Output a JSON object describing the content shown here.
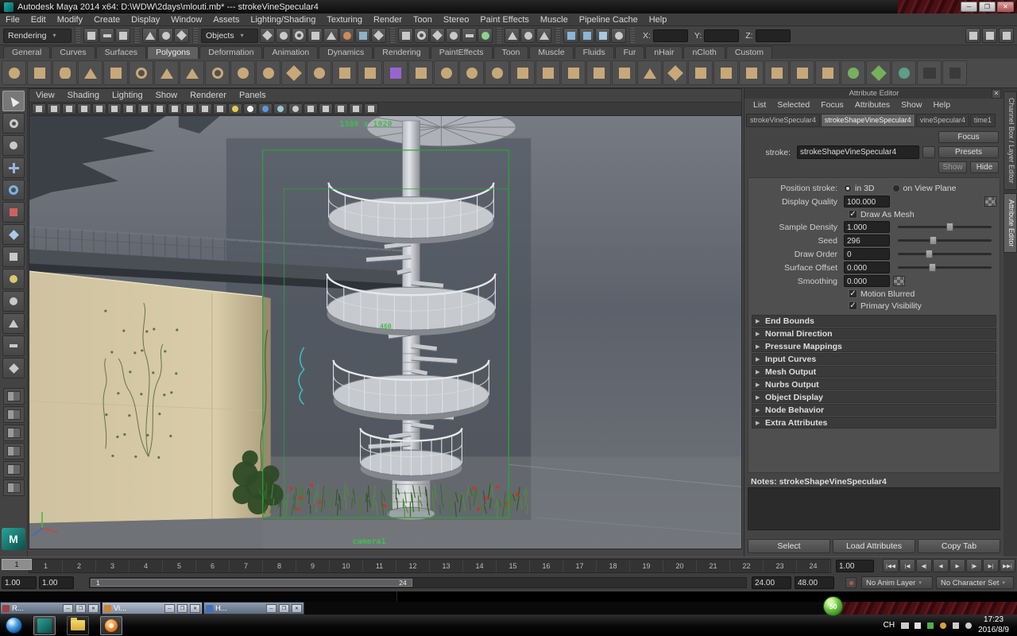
{
  "window": {
    "title": "Autodesk Maya 2014 x64: D:\\WDW\\2days\\mlouti.mb*   --- strokeVineSpecular4"
  },
  "menu_bar": [
    "File",
    "Edit",
    "Modify",
    "Create",
    "Display",
    "Window",
    "Assets",
    "Lighting/Shading",
    "Texturing",
    "Render",
    "Toon",
    "Stereo",
    "Paint Effects",
    "Muscle",
    "Pipeline Cache",
    "Help"
  ],
  "status_line": {
    "menu_set": "Rendering",
    "selection_mask_label": "Objects",
    "coords": {
      "x_label": "X:",
      "x_value": "",
      "y_label": "Y:",
      "y_value": "",
      "z_label": "Z:",
      "z_value": ""
    },
    "file_icons": [
      {
        "name": "new-scene-icon",
        "shape": "sq"
      },
      {
        "name": "open-scene-icon",
        "shape": "pl"
      },
      {
        "name": "save-scene-icon",
        "shape": "sq"
      }
    ],
    "selection_mode_icons": [
      {
        "name": "select-hierarchy-icon",
        "shape": "tr"
      },
      {
        "name": "select-object-icon",
        "shape": "ci"
      },
      {
        "name": "select-component-icon",
        "shape": "di"
      }
    ],
    "mask_icons": [
      {
        "name": "select-handles-icon",
        "shape": "di"
      },
      {
        "name": "select-joints-icon",
        "shape": "ci"
      },
      {
        "name": "select-curves-icon",
        "shape": "to"
      },
      {
        "name": "select-surfaces-icon",
        "shape": "sq"
      },
      {
        "name": "select-deformations-icon",
        "shape": "tr"
      },
      {
        "name": "select-dynamics-icon",
        "shape": "ci",
        "color": "#d08a5a"
      },
      {
        "name": "select-rendering-icon",
        "shape": "sq",
        "color": "#8fb3c8"
      },
      {
        "name": "select-misc-icon",
        "shape": "di"
      }
    ],
    "snap_icons": [
      {
        "name": "snap-to-grid-icon",
        "shape": "sq"
      },
      {
        "name": "snap-to-curve-icon",
        "shape": "to"
      },
      {
        "name": "snap-to-point-icon",
        "shape": "di"
      },
      {
        "name": "snap-to-projected-center-icon",
        "shape": "ci"
      },
      {
        "name": "snap-to-view-plane-icon",
        "shape": "pl"
      },
      {
        "name": "make-live-icon",
        "shape": "ci",
        "color": "#8fd18f"
      }
    ],
    "history_icons": [
      {
        "name": "input-connections-icon",
        "shape": "tr"
      },
      {
        "name": "construction-history-icon",
        "shape": "ci"
      },
      {
        "name": "output-connections-icon",
        "shape": "tr"
      }
    ],
    "render_icons": [
      {
        "name": "render-view-icon",
        "shape": "sq",
        "color": "#8ab6d8"
      },
      {
        "name": "render-current-frame-icon",
        "shape": "sq",
        "color": "#8ab6d8"
      },
      {
        "name": "ipr-render-icon",
        "shape": "sq",
        "color": "#a8c8e0"
      },
      {
        "name": "render-settings-icon",
        "shape": "ci"
      }
    ],
    "sidebar_icons": [
      {
        "name": "sidebar-attribute-editor-icon",
        "shape": "sq"
      },
      {
        "name": "sidebar-tool-settings-icon",
        "shape": "sq"
      },
      {
        "name": "sidebar-channel-box-icon",
        "shape": "sq"
      }
    ]
  },
  "shelf": {
    "tabs": [
      {
        "label": "General"
      },
      {
        "label": "Curves"
      },
      {
        "label": "Surfaces"
      },
      {
        "label": "Polygons",
        "active": true
      },
      {
        "label": "Deformation"
      },
      {
        "label": "Animation"
      },
      {
        "label": "Dynamics"
      },
      {
        "label": "Rendering"
      },
      {
        "label": "PaintEffects"
      },
      {
        "label": "Toon"
      },
      {
        "label": "Muscle"
      },
      {
        "label": "Fluids"
      },
      {
        "label": "Fur"
      },
      {
        "label": "nHair"
      },
      {
        "label": "nCloth"
      },
      {
        "label": "Custom"
      }
    ],
    "icons": [
      {
        "name": "poly-sphere-icon",
        "shape": "ci"
      },
      {
        "name": "poly-cube-icon",
        "shape": "sq"
      },
      {
        "name": "poly-cylinder-icon",
        "shape": "cy"
      },
      {
        "name": "poly-cone-icon",
        "shape": "tr"
      },
      {
        "name": "poly-plane-icon",
        "shape": "pl"
      },
      {
        "name": "poly-torus-icon",
        "shape": "to"
      },
      {
        "name": "poly-prism-icon",
        "shape": "tr"
      },
      {
        "name": "poly-pyramid-icon",
        "shape": "tr"
      },
      {
        "name": "poly-pipe-icon",
        "shape": "to"
      },
      {
        "name": "poly-helix-icon",
        "shape": "ci"
      },
      {
        "name": "poly-soccer-ball-icon",
        "shape": "ci"
      },
      {
        "name": "poly-platonic-solid-icon",
        "shape": "di"
      },
      {
        "name": "sculpt-geometry-icon",
        "shape": "ci"
      },
      {
        "name": "poly-combine-icon",
        "shape": "sq"
      },
      {
        "name": "poly-separate-icon",
        "shape": "sq"
      },
      {
        "name": "subdiv-cube-icon",
        "shape": "sq",
        "color": "#9a63d2"
      },
      {
        "name": "poly-extract-icon",
        "shape": "sq"
      },
      {
        "name": "boolean-union-icon",
        "shape": "ci"
      },
      {
        "name": "boolean-difference-icon",
        "shape": "ci"
      },
      {
        "name": "boolean-intersection-icon",
        "shape": "ci"
      },
      {
        "name": "poly-smooth-icon",
        "shape": "sq"
      },
      {
        "name": "poly-reduce-icon",
        "shape": "sq"
      },
      {
        "name": "poly-extrude-icon",
        "shape": "sq"
      },
      {
        "name": "poly-bridge-icon",
        "shape": "sq"
      },
      {
        "name": "append-to-polygon-icon",
        "shape": "sq"
      },
      {
        "name": "poly-wedge-icon",
        "shape": "tr"
      },
      {
        "name": "poly-poke-icon",
        "shape": "di"
      },
      {
        "name": "poly-cut-icon",
        "shape": "sq"
      },
      {
        "name": "split-polygon-icon",
        "shape": "sq"
      },
      {
        "name": "insert-edge-loop-icon",
        "shape": "sq"
      },
      {
        "name": "offset-edge-loop-icon",
        "shape": "sq"
      },
      {
        "name": "add-divisions-icon",
        "shape": "sq"
      },
      {
        "name": "poly-mirror-icon",
        "shape": "sq"
      },
      {
        "name": "merge-vertices-icon",
        "shape": "ci",
        "color": "#76b05c"
      },
      {
        "name": "target-weld-icon",
        "shape": "di",
        "color": "#76b05c"
      },
      {
        "name": "spin-edge-icon",
        "shape": "ci",
        "color": "#5c9e86"
      },
      {
        "name": "triangulate-icon",
        "shape": "tr",
        "color": "#3a3a3a"
      },
      {
        "name": "quadrangulate-icon",
        "shape": "sq",
        "color": "#3a3a3a"
      }
    ]
  },
  "toolbox": {
    "tools": [
      {
        "name": "select-tool",
        "shape": "ar",
        "active": true
      },
      {
        "name": "lasso-select-tool",
        "shape": "to"
      },
      {
        "name": "paint-select-tool",
        "shape": "ci"
      },
      {
        "name": "move-tool",
        "shape": "cr"
      },
      {
        "name": "rotate-tool",
        "shape": "rg"
      },
      {
        "name": "scale-tool",
        "shape": "sq",
        "color": "#d06060"
      },
      {
        "name": "show-manipulator-tool",
        "shape": "di",
        "color": "#b0c8e8"
      },
      {
        "name": "last-tool",
        "shape": "sq"
      },
      {
        "name": "soft-mod-tool",
        "shape": "ci",
        "color": "#d8c870"
      },
      {
        "name": "sculpt-tool",
        "shape": "ci"
      },
      {
        "name": "paint-effects-brush-tool",
        "shape": "tr"
      },
      {
        "name": "grease-pencil-tool",
        "shape": "pl"
      },
      {
        "name": "measure-tool",
        "shape": "di"
      }
    ],
    "layouts": [
      {
        "name": "layout-single-pane",
        "shape": "pane"
      },
      {
        "name": "layout-two-pane-side",
        "shape": "pane"
      },
      {
        "name": "layout-two-pane-stacked",
        "shape": "pane"
      },
      {
        "name": "layout-four-pane",
        "shape": "pane"
      },
      {
        "name": "layout-persp-outliner",
        "shape": "pane"
      },
      {
        "name": "layout-hypershade-persp",
        "shape": "pane"
      }
    ]
  },
  "viewport": {
    "menus": [
      "View",
      "Shading",
      "Lighting",
      "Show",
      "Renderer",
      "Panels"
    ],
    "toolbar_icons": [
      {
        "name": "select-camera-icon",
        "shape": "sq"
      },
      {
        "name": "camera-lock-icon",
        "shape": "sq"
      },
      {
        "name": "camera-attributes-icon",
        "shape": "sq"
      },
      {
        "name": "camera-bookmark-icon",
        "shape": "sq"
      },
      {
        "name": "image-plane-icon",
        "shape": "sq"
      },
      {
        "name": "two-d-pan-zoom-icon",
        "shape": "sq"
      },
      {
        "name": "grid-toggle-icon",
        "shape": "sq"
      },
      {
        "name": "film-gate-icon",
        "shape": "sq"
      },
      {
        "name": "resolution-gate-icon",
        "shape": "sq"
      },
      {
        "name": "gate-mask-icon",
        "shape": "sq"
      },
      {
        "name": "field-chart-icon",
        "shape": "sq"
      },
      {
        "name": "safe-action-icon",
        "shape": "sq"
      },
      {
        "name": "safe-title-icon",
        "shape": "sq"
      },
      {
        "name": "use-default-material-icon",
        "shape": "ci",
        "color": "#e3cf4b"
      },
      {
        "name": "lighting-toggle-icon",
        "shape": "ci",
        "color": "#f2f2f2"
      },
      {
        "name": "shadows-toggle-icon",
        "shape": "ci",
        "color": "#5b96e0"
      },
      {
        "name": "ambient-occlusion-icon",
        "shape": "ci",
        "color": "#9fc6d8"
      },
      {
        "name": "motion-blur-toggle-icon",
        "shape": "ci"
      },
      {
        "name": "wireframe-mode-icon",
        "shape": "sq"
      },
      {
        "name": "shaded-mode-icon",
        "shape": "sq"
      },
      {
        "name": "textured-mode-icon",
        "shape": "sq"
      },
      {
        "name": "xray-mode-icon",
        "shape": "sq"
      },
      {
        "name": "isolate-select-icon",
        "shape": "sq"
      }
    ],
    "resolution_label": "1300 x 1920",
    "gate_label": "460",
    "camera_label": "camera1"
  },
  "attribute_editor": {
    "title": "Attribute Editor",
    "close_glyph": "✕",
    "menus": [
      "List",
      "Selected",
      "Focus",
      "Attributes",
      "Show",
      "Help"
    ],
    "tabs": [
      {
        "label": "strokeVineSpecular4"
      },
      {
        "label": "strokeShapeVineSpecular4",
        "active": true
      },
      {
        "label": "vineSpecular4"
      },
      {
        "label": "time1"
      }
    ],
    "stroke_label": "stroke:",
    "stroke_value": "strokeShapeVineSpecular4",
    "focus_button": "Focus",
    "presets_button": "Presets",
    "show_button": "Show",
    "hide_button": "Hide",
    "position_stroke": {
      "label": "Position stroke:",
      "options": [
        {
          "label": "in 3D",
          "selected": true
        },
        {
          "label": "on View Plane",
          "selected": false
        }
      ]
    },
    "display_quality": {
      "label": "Display Quality",
      "value": "100.000"
    },
    "draw_as_mesh": {
      "label": "Draw As Mesh",
      "checked": true
    },
    "sample_density": {
      "label": "Sample Density",
      "value": "1.000"
    },
    "seed": {
      "label": "Seed",
      "value": "296"
    },
    "draw_order": {
      "label": "Draw Order",
      "value": "0"
    },
    "surface_offset": {
      "label": "Surface Offset",
      "value": "0.000"
    },
    "smoothing": {
      "label": "Smoothing",
      "value": "0.000"
    },
    "motion_blurred": {
      "label": "Motion Blurred",
      "checked": true
    },
    "primary_visibility": {
      "label": "Primary Visibility",
      "checked": true
    },
    "sections": [
      {
        "label": "End Bounds",
        "name": "end-bounds-section"
      },
      {
        "label": "Normal Direction",
        "name": "normal-direction-section"
      },
      {
        "label": "Pressure Mappings",
        "name": "pressure-mappings-section"
      },
      {
        "label": "Input Curves",
        "name": "input-curves-section"
      },
      {
        "label": "Mesh Output",
        "name": "mesh-output-section"
      },
      {
        "label": "Nurbs Output",
        "name": "nurbs-output-section"
      },
      {
        "label": "Object Display",
        "name": "object-display-section"
      },
      {
        "label": "Node Behavior",
        "name": "node-behavior-section"
      },
      {
        "label": "Extra Attributes",
        "name": "extra-attributes-section"
      }
    ],
    "notes_label": "Notes: strokeShapeVineSpecular4",
    "footer_buttons": [
      {
        "label": "Select",
        "name": "select-button"
      },
      {
        "label": "Load Attributes",
        "name": "load-attributes-button"
      },
      {
        "label": "Copy Tab",
        "name": "copy-tab-button"
      }
    ]
  },
  "sidebar_tabs": [
    {
      "label": "Channel Box / Layer Editor",
      "name": "channel-box-layer-editor-tab"
    },
    {
      "label": "Attribute Editor",
      "name": "attribute-editor-tab",
      "active": true
    }
  ],
  "timeline": {
    "ticks": [
      "1",
      "2",
      "3",
      "4",
      "5",
      "6",
      "7",
      "8",
      "9",
      "10",
      "11",
      "12",
      "13",
      "14",
      "15",
      "16",
      "17",
      "18",
      "19",
      "20",
      "21",
      "22",
      "23",
      "24"
    ],
    "current_frame": "1",
    "current_time_field": "1.00",
    "playback_buttons": [
      {
        "name": "go-to-start-button",
        "glyph": "|◀◀"
      },
      {
        "name": "step-back-key-button",
        "glyph": "|◀"
      },
      {
        "name": "step-back-frame-button",
        "glyph": "◀|"
      },
      {
        "name": "play-backwards-button",
        "glyph": "◀"
      },
      {
        "name": "play-forwards-button",
        "glyph": "▶"
      },
      {
        "name": "step-forward-frame-button",
        "glyph": "|▶"
      },
      {
        "name": "step-forward-key-button",
        "glyph": "▶|"
      },
      {
        "name": "go-to-end-button",
        "glyph": "▶▶|"
      }
    ]
  },
  "range_slider": {
    "anim_start": "1.00",
    "playback_start": "1.00",
    "range_start_label": "1",
    "range_end_label": "24",
    "playback_end": "24.00",
    "anim_end": "48.00",
    "anim_layer": "No Anim Layer",
    "character_set": "No Character Set"
  },
  "mini_windows": [
    {
      "label": "R...",
      "name": "minimized-window-r",
      "color": "#a04040"
    },
    {
      "label": "Vi...",
      "name": "minimized-window-vi",
      "color": "#d08030",
      "active": true
    },
    {
      "label": "H...",
      "name": "minimized-window-h",
      "color": "#4070c0"
    }
  ],
  "taskbar": {
    "quick_launch": [
      {
        "name": "maya-taskbar-button",
        "kind": "maya",
        "active": true
      },
      {
        "name": "explorer-taskbar-button",
        "kind": "folder"
      },
      {
        "name": "browser-taskbar-button",
        "kind": "browser",
        "active": true
      }
    ],
    "tray": {
      "lang": "CH",
      "time": "17:23",
      "date": "2016/8/9",
      "icons": [
        {
          "name": "hidden-icons-button",
          "shape": "tr",
          "color": "#cccccc"
        },
        {
          "name": "ime-tray-icon",
          "shape": "sq",
          "color": "#e0e0e0"
        },
        {
          "name": "safety-tray-icon",
          "shape": "sq",
          "color": "#4fae4f"
        },
        {
          "name": "update-tray-icon",
          "shape": "ci",
          "color": "#d8a040"
        },
        {
          "name": "network-tray-icon",
          "shape": "sq",
          "color": "#cccccc"
        },
        {
          "name": "volume-tray-icon",
          "shape": "ci",
          "color": "#cccccc"
        }
      ]
    },
    "float_badge": "50"
  }
}
